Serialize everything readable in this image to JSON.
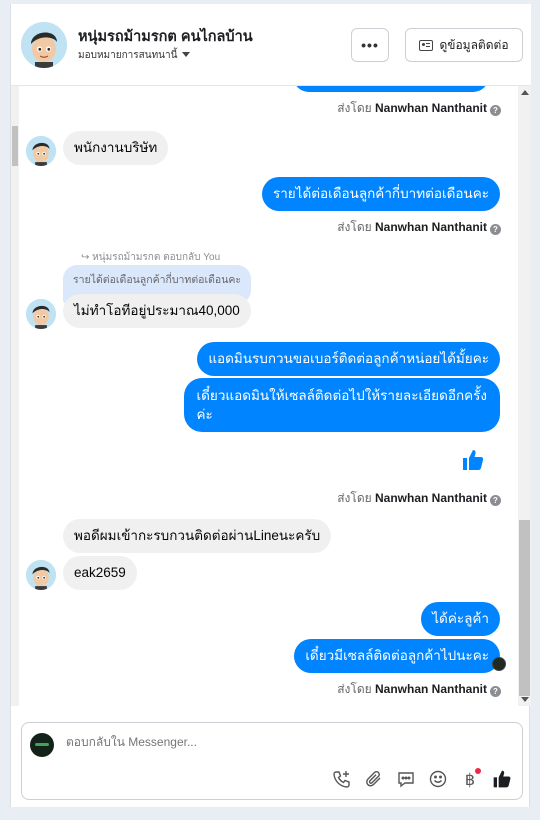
{
  "header": {
    "name": "หนุ่มรถม้ามรกต คนไกลบ้าน",
    "subtitle": "มอบหมายการสนทนานี้",
    "more_label": "•••",
    "contact_label": "ดูข้อมูลติดต่อ",
    "more_icon": "more-horizontal-icon",
    "contact_icon": "contact-card-icon"
  },
  "messages": {
    "sent_by_1": {
      "prefix": "ส่งโดย",
      "name": "Nanwhan Nanthanit"
    },
    "m1": "พนักงานบริษัท",
    "m2": "รายได้ต่อเดือนลูกค้ากี่บาทต่อเดือนคะ",
    "sent_by_2": {
      "prefix": "ส่งโดย",
      "name": "Nanwhan Nanthanit"
    },
    "reply_label": "หนุ่มรถม้ามรกต ตอบกลับ You",
    "quoted": "รายได้ต่อเดือนลูกค้ากี่บาทต่อเดือนคะ",
    "m3": "ไม่ทำโอทีอยู่ประมาณ40,000",
    "m4": "แอดมินรบกวนขอเบอร์ติดต่อลูกค้าหน่อยได้มั้ยคะ",
    "m5_line1": "เดี๋ยวแอดมินให้เซลล์ติดต่อไปให้รายละเอียดอีกครั้ง",
    "m5_line2": "ค่ะ",
    "like_icon": "thumbs-up-icon",
    "sent_by_3": {
      "prefix": "ส่งโดย",
      "name": "Nanwhan Nanthanit"
    },
    "m6": "พอดีผมเข้ากะรบกวนติดต่อผ่านLineนะครับ",
    "m7": "eak2659",
    "m8": "ได้ค่ะลูค้า",
    "m9": "เดี๋ยวมีเซลล์ติดต่อลูกค้าไปนะคะ",
    "sent_by_4": {
      "prefix": "ส่งโดย",
      "name": "Nanwhan Nanthanit"
    }
  },
  "composer": {
    "placeholder": "ตอบกลับใน Messenger...",
    "tools": [
      "call-add-icon",
      "paperclip-icon",
      "saved-reply-icon",
      "emoji-icon",
      "baht-payment-icon",
      "thumbs-up-icon"
    ]
  },
  "colors": {
    "outgoing": "#0084ff",
    "incoming": "#f0f0f0",
    "quoted": "#dbe7fb"
  }
}
